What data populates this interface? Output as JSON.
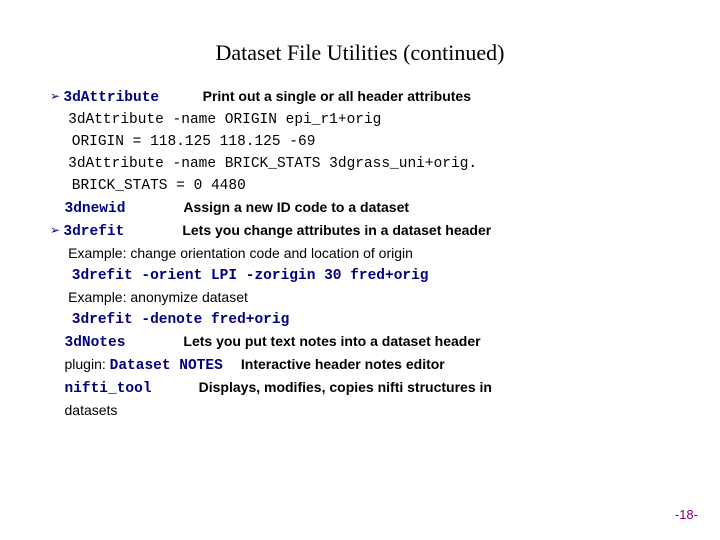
{
  "title": "Dataset File Utilities (continued)",
  "lines": {
    "b1": "➢ ",
    "c1": "3dAttribute",
    "d1": "Print out a single or all header attributes",
    "m2": "3dAttribute -name ORIGIN epi_r1+orig",
    "m3": "ORIGIN = 118.125 118.125 -69",
    "m4": "3dAttribute -name BRICK_STATS 3dgrass_uni+orig.",
    "m5": "BRICK_STATS = 0 4480",
    "c6": "3dnewid",
    "d6": "Assign a new ID code to a dataset",
    "b7": "➢ ",
    "c7": "3drefit",
    "d7": "Lets you change attributes in a dataset header",
    "p8": "Example: change orientation code and location of origin",
    "c9": "3drefit -orient LPI -zorigin 30 fred+orig",
    "p10": "Example: anonymize dataset",
    "c11": "3drefit -denote fred+orig",
    "c12": "3dNotes",
    "d12": "Lets you put text notes into a dataset header",
    "p13a": "plugin: ",
    "c13": "Dataset NOTES",
    "d13": "Interactive header notes editor",
    "c14": "nifti_tool",
    "d14": "Displays, modifies, copies nifti structures in",
    "p15": "datasets"
  },
  "pagenum": "-18-"
}
